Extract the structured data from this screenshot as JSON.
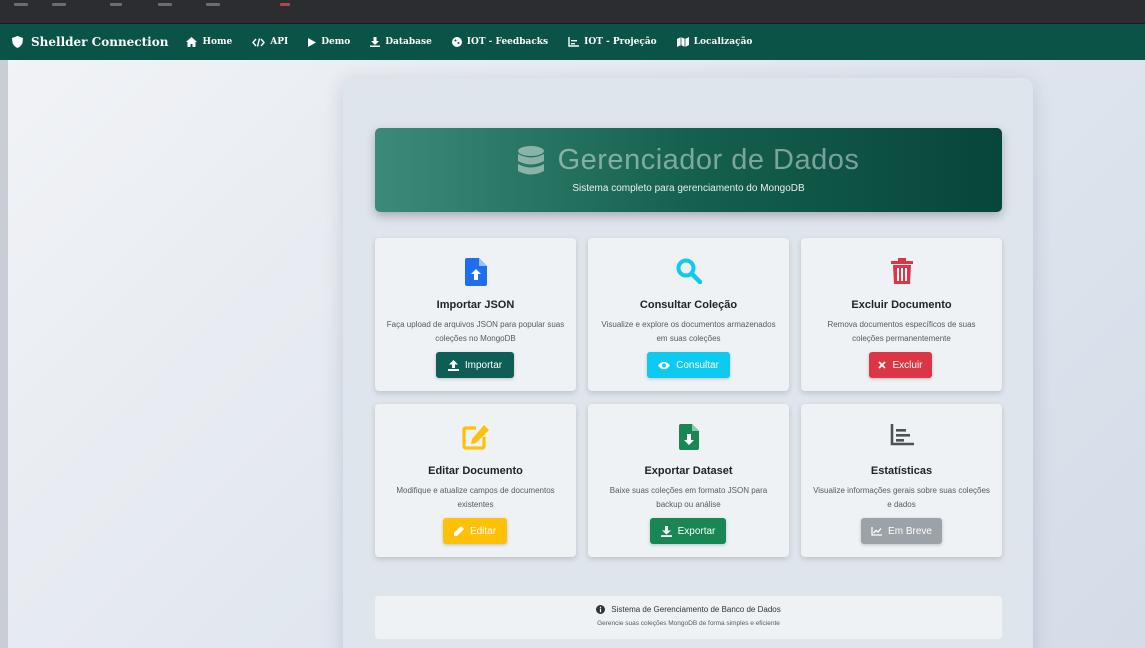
{
  "navbar": {
    "brand": "Shellder Connection",
    "items": [
      {
        "label": "Home",
        "icon": "home-icon"
      },
      {
        "label": "API",
        "icon": "code-icon"
      },
      {
        "label": "Demo",
        "icon": "play-icon"
      },
      {
        "label": "Database",
        "icon": "download-icon"
      },
      {
        "label": "IOT - Feedbacks",
        "icon": "cookie-icon"
      },
      {
        "label": "IOT - Projeção",
        "icon": "chart-icon"
      },
      {
        "label": "Localização",
        "icon": "map-icon"
      }
    ]
  },
  "hero": {
    "title": "Gerenciador de Dados",
    "subtitle": "Sistema completo para gerenciamento do MongoDB"
  },
  "cards": [
    {
      "title": "Importar JSON",
      "desc": "Faça upload de arquivos JSON para popular suas coleções no MongoDB",
      "button": "Importar",
      "color": "#0f5d57"
    },
    {
      "title": "Consultar Coleção",
      "desc": "Visualize e explore os documentos armazenados em suas coleções",
      "button": "Consultar",
      "color": "#0dcaf0"
    },
    {
      "title": "Excluir Documento",
      "desc": "Remova documentos específicos de suas coleções permanentemente",
      "button": "Excluir",
      "color": "#dc3545"
    },
    {
      "title": "Editar Documento",
      "desc": "Modifique e atualize campos de documentos existentes",
      "button": "Editar",
      "color": "#ffc107"
    },
    {
      "title": "Exportar Dataset",
      "desc": "Baixe suas coleções em formato JSON para backup ou análise",
      "button": "Exportar",
      "color": "#198754"
    },
    {
      "title": "Estatísticas",
      "desc": "Visualize informações gerais sobre suas coleções e dados",
      "button": "Em Breve",
      "color": "#9ca3a8"
    }
  ],
  "footer": {
    "title": "Sistema de Gerenciamento de Banco de Dados",
    "subtitle": "Gerencie suas coleções MongoDB de forma simples e eficiente"
  }
}
